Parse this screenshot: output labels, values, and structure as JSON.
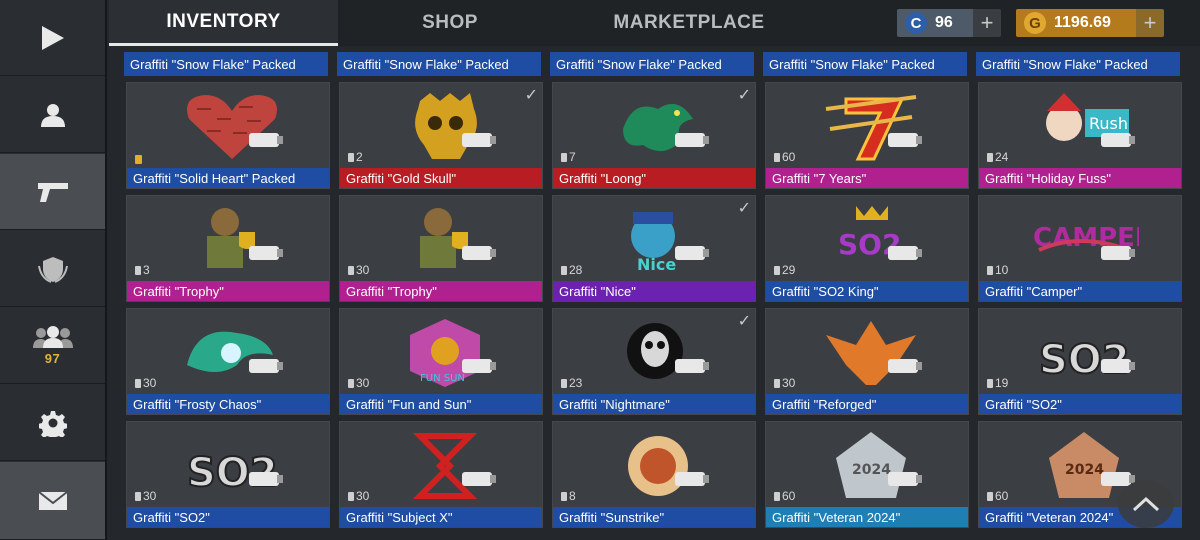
{
  "sidebar": {
    "play": "play-icon",
    "profile": "profile-icon",
    "weapons": "pistol-icon",
    "clan": "clan-shield-icon",
    "friends": "friends-icon",
    "friends_count": "97",
    "settings": "gear-icon",
    "mail": "mail-icon"
  },
  "tabs": [
    {
      "label": "INVENTORY"
    },
    {
      "label": "SHOP"
    },
    {
      "label": "MARKETPLACE"
    }
  ],
  "currency": {
    "silver": {
      "symbol": "C",
      "amount": "96",
      "color": "#2c5fa8"
    },
    "gold": {
      "symbol": "G",
      "amount": "1196.69",
      "color": "#b47b1c"
    },
    "plus": "+"
  },
  "top_strip": [
    "Graffiti \"Snow Flake\" Packed",
    "Graffiti \"Snow Flake\" Packed",
    "Graffiti \"Snow Flake\" Packed",
    "Graffiti \"Snow Flake\" Packed",
    "Graffiti \"Snow Flake\" Packed"
  ],
  "rows": [
    [
      {
        "label": "Graffiti \"Solid Heart\" Packed",
        "count": "",
        "locked": true,
        "checked": false,
        "color": "#1e4da3",
        "art": "heart"
      },
      {
        "label": "Graffiti \"Gold Skull\"",
        "count": "2",
        "locked": false,
        "checked": true,
        "color": "#b81d24",
        "art": "skull"
      },
      {
        "label": "Graffiti \"Loong\"",
        "count": "7",
        "locked": false,
        "checked": true,
        "color": "#b81d24",
        "art": "dragon"
      },
      {
        "label": "Graffiti \"7 Years\"",
        "count": "60",
        "locked": false,
        "checked": false,
        "color": "#b0208f",
        "art": "seven"
      },
      {
        "label": "Graffiti \"Holiday Fuss\"",
        "count": "24",
        "locked": false,
        "checked": false,
        "color": "#b0208f",
        "art": "holiday"
      }
    ],
    [
      {
        "label": "Graffiti \"Trophy\"",
        "count": "3",
        "locked": false,
        "checked": false,
        "color": "#b0208f",
        "art": "trophy"
      },
      {
        "label": "Graffiti \"Trophy\"",
        "count": "30",
        "locked": false,
        "checked": false,
        "color": "#b0208f",
        "art": "trophy"
      },
      {
        "label": "Graffiti \"Nice\"",
        "count": "28",
        "locked": false,
        "checked": true,
        "color": "#6b22b0",
        "art": "nice"
      },
      {
        "label": "Graffiti \"SO2 King\"",
        "count": "29",
        "locked": false,
        "checked": false,
        "color": "#1e4da3",
        "art": "so2king"
      },
      {
        "label": "Graffiti \"Camper\"",
        "count": "10",
        "locked": false,
        "checked": false,
        "color": "#1e4da3",
        "art": "camper"
      }
    ],
    [
      {
        "label": "Graffiti \"Frosty Chaos\"",
        "count": "30",
        "locked": false,
        "checked": false,
        "color": "#1e4da3",
        "art": "frosty"
      },
      {
        "label": "Graffiti \"Fun and Sun\"",
        "count": "30",
        "locked": false,
        "checked": false,
        "color": "#1e4da3",
        "art": "fun"
      },
      {
        "label": "Graffiti \"Nightmare\"",
        "count": "23",
        "locked": false,
        "checked": true,
        "color": "#1e4da3",
        "art": "nightmare"
      },
      {
        "label": "Graffiti \"Reforged\"",
        "count": "30",
        "locked": false,
        "checked": false,
        "color": "#1e4da3",
        "art": "reforged"
      },
      {
        "label": "Graffiti \"SO2\"",
        "count": "19",
        "locked": false,
        "checked": false,
        "color": "#1e4da3",
        "art": "so2"
      }
    ],
    [
      {
        "label": "Graffiti \"SO2\"",
        "count": "30",
        "locked": false,
        "checked": false,
        "color": "#1e4da3",
        "art": "so2"
      },
      {
        "label": "Graffiti \"Subject X\"",
        "count": "30",
        "locked": false,
        "checked": false,
        "color": "#1e4da3",
        "art": "subjectx"
      },
      {
        "label": "Graffiti \"Sunstrike\"",
        "count": "8",
        "locked": false,
        "checked": false,
        "color": "#1e4da3",
        "art": "sunstrike"
      },
      {
        "label": "Graffiti \"Veteran 2024\"",
        "count": "60",
        "locked": false,
        "checked": false,
        "color": "#1f7fb5",
        "art": "veteran"
      },
      {
        "label": "Graffiti \"Veteran 2024\"",
        "count": "60",
        "locked": false,
        "checked": false,
        "color": "#1e4da3",
        "art": "veteran2"
      }
    ]
  ],
  "scroll_up": "chevron-up-icon",
  "checkmark": "✓"
}
